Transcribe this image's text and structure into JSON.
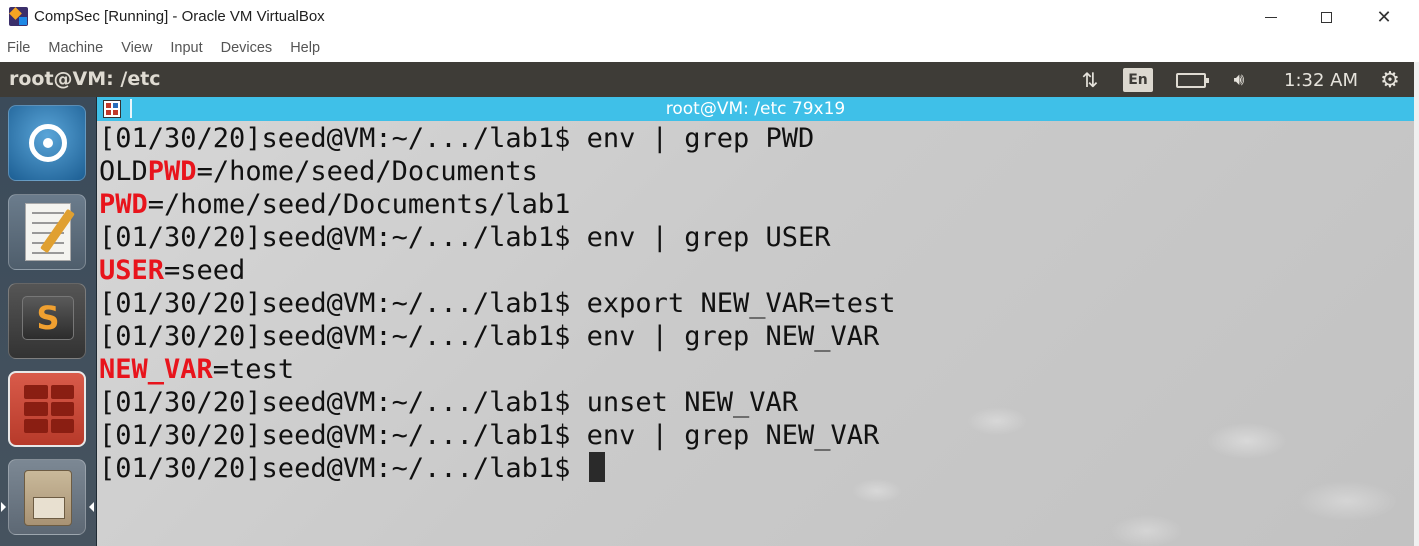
{
  "host_window": {
    "title": "CompSec [Running] - Oracle VM VirtualBox",
    "controls": {
      "minimize": "",
      "maximize": "",
      "close": "✕"
    },
    "menu": [
      "File",
      "Machine",
      "View",
      "Input",
      "Devices",
      "Help"
    ]
  },
  "guest_panel": {
    "title": "root@VM: /etc",
    "keyboard_layout": "En",
    "clock": "1:32 AM",
    "icons": {
      "network": "network-arrows-icon",
      "battery": "battery-icon",
      "volume": "volume-icon",
      "settings": "gear-icon"
    }
  },
  "launcher": {
    "items": [
      "ubuntu-dash",
      "text-editor",
      "sublime-text",
      "terminal",
      "file-manager"
    ]
  },
  "terminal": {
    "title": "root@VM: /etc 79x19",
    "lines": [
      {
        "prompt": "[01/30/20]seed@VM:~/.../lab1$",
        "command": " env | grep PWD"
      },
      {
        "pre": "OLD",
        "match": "PWD",
        "post": "=/home/seed/Documents"
      },
      {
        "pre": "",
        "match": "PWD",
        "post": "=/home/seed/Documents/lab1"
      },
      {
        "prompt": "[01/30/20]seed@VM:~/.../lab1$",
        "command": " env | grep USER"
      },
      {
        "pre": "",
        "match": "USER",
        "post": "=seed"
      },
      {
        "prompt": "[01/30/20]seed@VM:~/.../lab1$",
        "command": " export NEW_VAR=test"
      },
      {
        "prompt": "[01/30/20]seed@VM:~/.../lab1$",
        "command": " env | grep NEW_VAR"
      },
      {
        "pre": "",
        "match": "NEW_VAR",
        "post": "=test"
      },
      {
        "prompt": "[01/30/20]seed@VM:~/.../lab1$",
        "command": " unset NEW_VAR"
      },
      {
        "prompt": "[01/30/20]seed@VM:~/.../lab1$",
        "command": " env | grep NEW_VAR"
      },
      {
        "prompt": "[01/30/20]seed@VM:~/.../lab1$",
        "command": " "
      }
    ],
    "colors": {
      "match": "#e8141c",
      "text": "#111111",
      "titlebar": "#3fc0e8"
    }
  }
}
